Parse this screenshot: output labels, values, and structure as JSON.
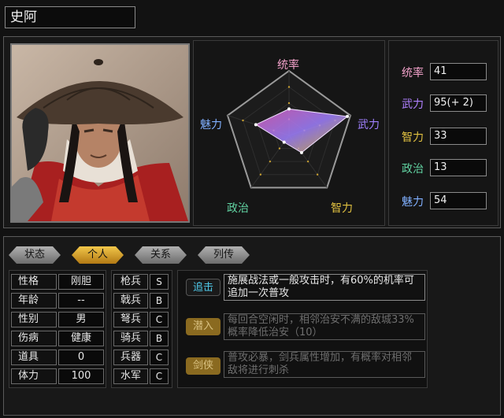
{
  "character": {
    "name": "史阿"
  },
  "radar": {
    "labels": {
      "top": "统率",
      "right": "武力",
      "bottom_right": "智力",
      "bottom_left": "政治",
      "left": "魅力"
    },
    "values": {
      "统率": 41,
      "武力": 95,
      "智力": 33,
      "政治": 13,
      "魅力": 54
    },
    "max": 100,
    "colors": {
      "label_top": "#f0a0c8",
      "label_right": "#a080ff",
      "label_bottom_right": "#e0c040",
      "label_bottom_left": "#60d0a0",
      "label_left": "#80b0ff"
    }
  },
  "stats": [
    {
      "label": "统率",
      "value": "41",
      "color": "#f0a0c8"
    },
    {
      "label": "武力",
      "value": "95(+ 2)",
      "color": "#b080ff"
    },
    {
      "label": "智力",
      "value": "33",
      "color": "#e0c040"
    },
    {
      "label": "政治",
      "value": "13",
      "color": "#60d0a0"
    },
    {
      "label": "魅力",
      "value": "54",
      "color": "#80b0ff"
    }
  ],
  "tabs": [
    {
      "label": "状态",
      "active": false
    },
    {
      "label": "个人",
      "active": true
    },
    {
      "label": "关系",
      "active": false
    },
    {
      "label": "列传",
      "active": false
    }
  ],
  "info": [
    {
      "label": "性格",
      "value": "刚胆"
    },
    {
      "label": "年龄",
      "value": "--"
    },
    {
      "label": "性别",
      "value": "男"
    },
    {
      "label": "伤病",
      "value": "健康"
    },
    {
      "label": "道具",
      "value": "0"
    },
    {
      "label": "体力",
      "value": "100"
    }
  ],
  "troops": [
    {
      "label": "枪兵",
      "grade": "S"
    },
    {
      "label": "戟兵",
      "grade": "B"
    },
    {
      "label": "弩兵",
      "grade": "C"
    },
    {
      "label": "骑兵",
      "grade": "B"
    },
    {
      "label": "兵器",
      "grade": "C"
    },
    {
      "label": "水军",
      "grade": "C"
    }
  ],
  "skills": [
    {
      "name": "追击",
      "desc": "施展战法或一般攻击时，有60%的机率可追加一次普攻",
      "active": true,
      "color": "#4ec8e8"
    },
    {
      "name": "潜入",
      "desc": "每回合空闲时，相邻治安不满的敌城33%概率降低治安（10）",
      "active": false,
      "color": "#8a6a20"
    },
    {
      "name": "剑侠",
      "desc": "普攻必暴，剑兵属性增加，有概率对相邻敌将进行刺杀",
      "active": false,
      "color": "#8a6a20"
    }
  ]
}
